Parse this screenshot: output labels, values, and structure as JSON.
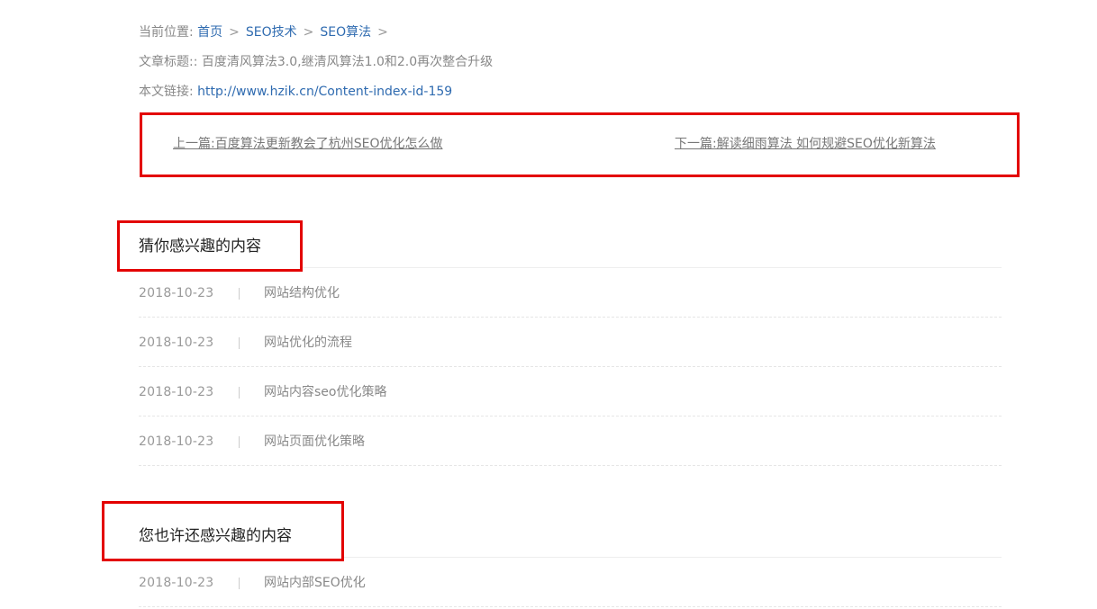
{
  "breadcrumb": {
    "label": "当前位置:",
    "items": [
      "首页",
      "SEO技术",
      "SEO算法"
    ],
    "separator": ">"
  },
  "article": {
    "title_label": "文章标题::",
    "title": "百度清风算法3.0,继清风算法1.0和2.0再次整合升级",
    "link_label": "本文链接:",
    "link": "http://www.hzik.cn/Content-index-id-159"
  },
  "prevnext": {
    "prev": "上一篇:百度算法更新教会了杭州SEO优化怎么做",
    "next": "下一篇:解读细雨算法 如何规避SEO优化新算法"
  },
  "related": {
    "heading": "猜你感兴趣的内容",
    "items": [
      {
        "date": "2018-10-23",
        "title": "网站结构优化"
      },
      {
        "date": "2018-10-23",
        "title": "网站优化的流程"
      },
      {
        "date": "2018-10-23",
        "title": "网站内容seo优化策略"
      },
      {
        "date": "2018-10-23",
        "title": "网站页面优化策略"
      }
    ]
  },
  "more": {
    "heading": "您也许还感兴趣的内容",
    "items": [
      {
        "date": "2018-10-23",
        "title": "网站内部SEO优化"
      }
    ]
  },
  "colors": {
    "link": "#2f6bb0",
    "highlight_border": "#e30000",
    "text_muted": "#888888"
  }
}
